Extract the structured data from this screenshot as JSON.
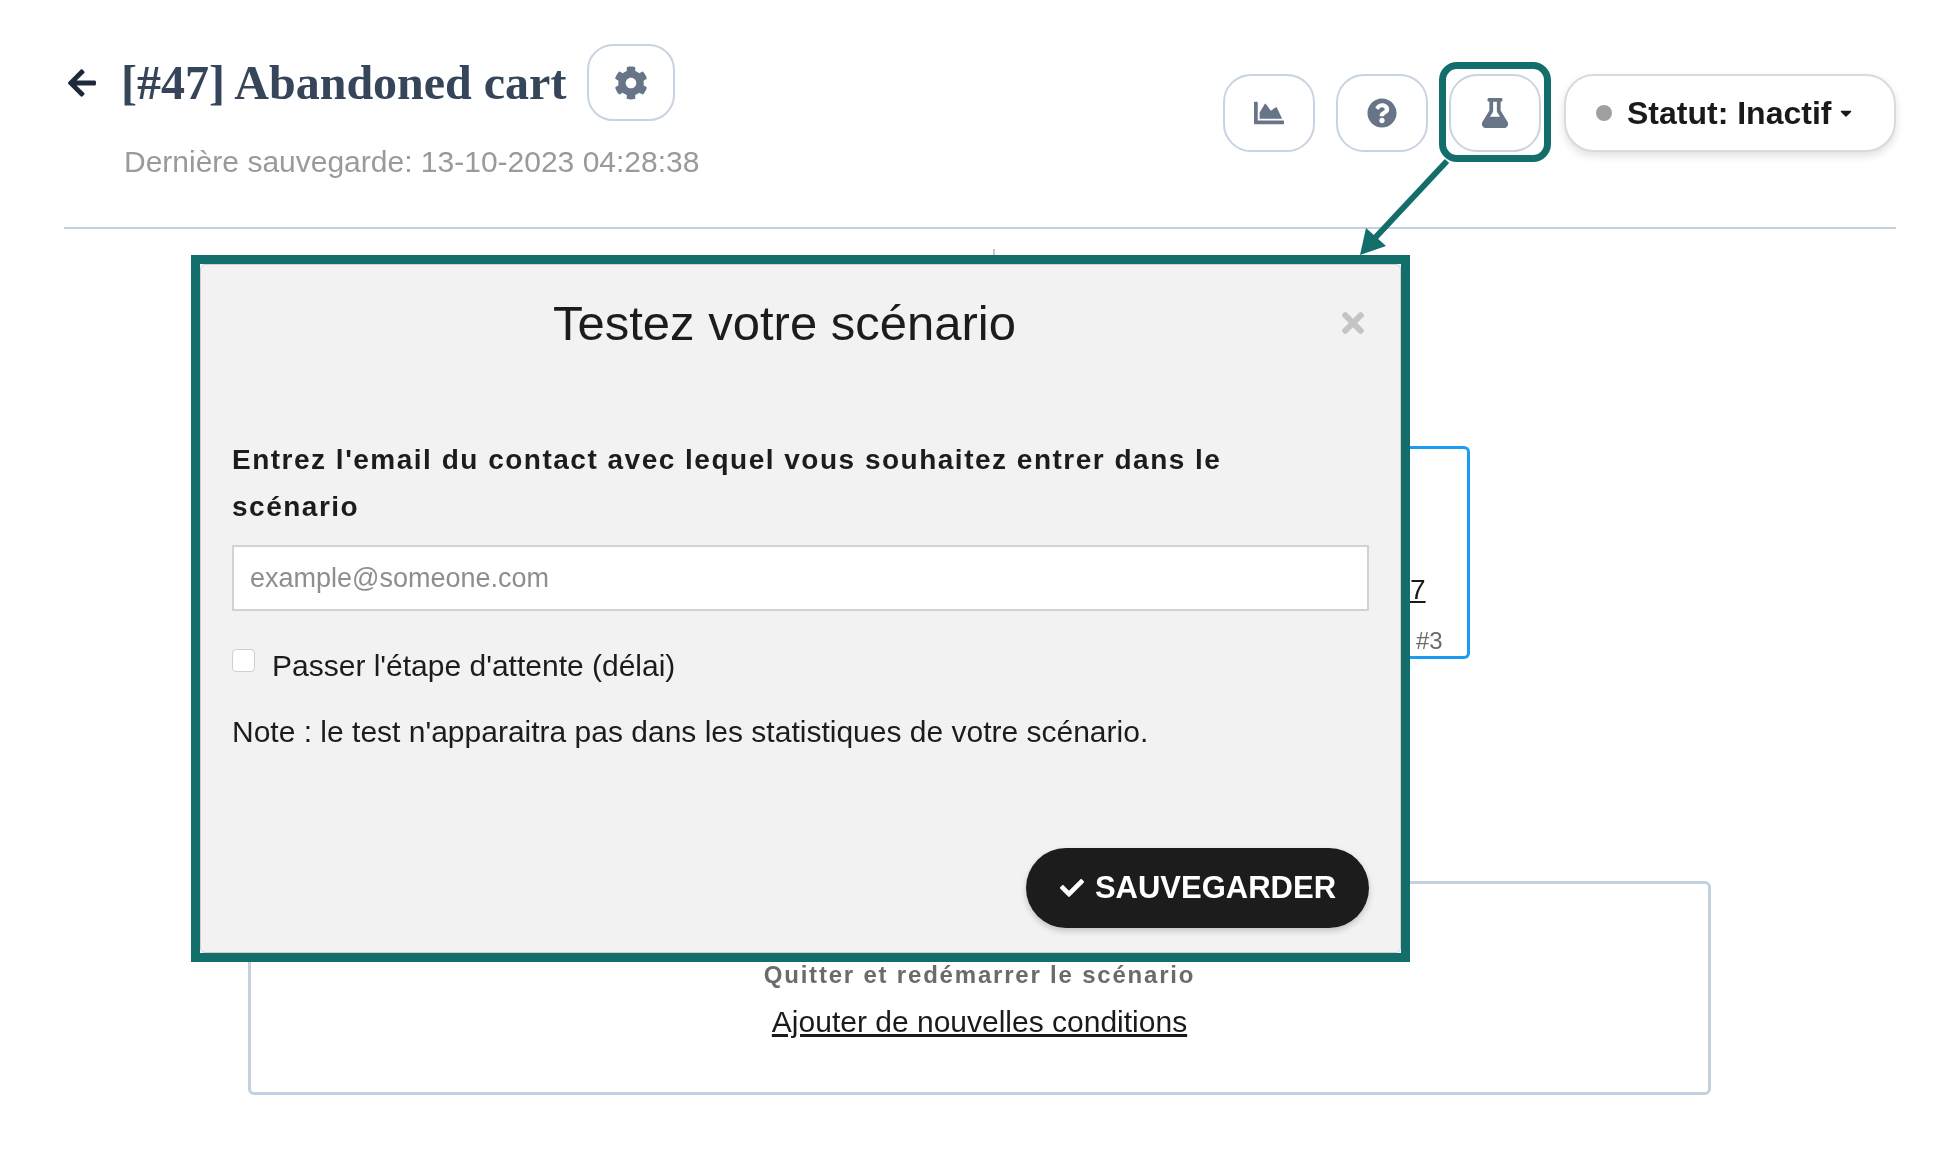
{
  "header": {
    "title": "[#47] Abandoned cart",
    "last_saved": "Dernière sauvegarde: 13-10-2023 04:28:38"
  },
  "toolbar": [
    {
      "highlighted": false
    },
    {
      "highlighted": false
    },
    {
      "highlighted": true
    }
  ],
  "status": {
    "label": "Statut: Inactif",
    "active": false
  },
  "canvas": {
    "step": {
      "link": "7",
      "number": "#3",
      "selected": true
    },
    "condition": {
      "caption": "Quitter et redémarrer le scénario",
      "link": "Ajouter de nouvelles conditions"
    }
  },
  "modal": {
    "highlighted": true,
    "title": "Testez votre scénario",
    "email_label": "Entrez l'email du contact avec lequel vous souhaitez entrer dans le scénario",
    "email_field": {
      "placeholder": "example@someone.com"
    },
    "skip_delay": {
      "label": "Passer l'étape d'attente (délai)",
      "checked": false
    },
    "note": "Note : le test n'apparaitra pas dans les statistiques de votre scénario.",
    "save_button": "SAUVEGARDER"
  }
}
